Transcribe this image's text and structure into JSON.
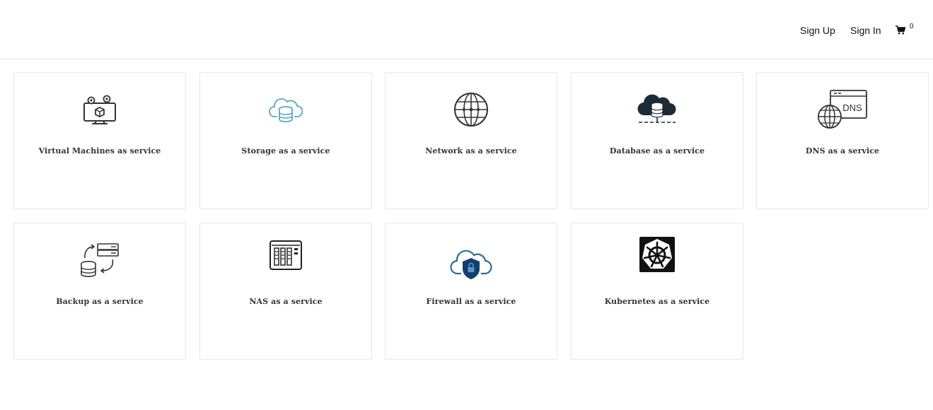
{
  "header": {
    "signup_label": "Sign Up",
    "signin_label": "Sign In",
    "cart_icon": "shopping-cart-icon",
    "cart_count": "0"
  },
  "services": [
    {
      "label": "Virtual Machines as service",
      "icon": "virtual-machine-icon"
    },
    {
      "label": "Storage as a service",
      "icon": "cloud-storage-icon"
    },
    {
      "label": "Network as a service",
      "icon": "network-globe-icon"
    },
    {
      "label": "Database as a service",
      "icon": "cloud-database-icon"
    },
    {
      "label": "DNS as a service",
      "icon": "dns-globe-icon",
      "icon_text": "DNS"
    },
    {
      "label": "Backup as a service",
      "icon": "backup-sync-icon"
    },
    {
      "label": "NAS as a service",
      "icon": "nas-device-icon"
    },
    {
      "label": "Firewall as a service",
      "icon": "cloud-firewall-lock-icon"
    },
    {
      "label": "Kubernetes as a service",
      "icon": "kubernetes-helm-icon"
    }
  ],
  "colors": {
    "storage_accent": "#5aa9c4",
    "database_dark": "#1c2b36",
    "firewall_blue": "#2d6b9a",
    "firewall_dark": "#123f6e"
  }
}
